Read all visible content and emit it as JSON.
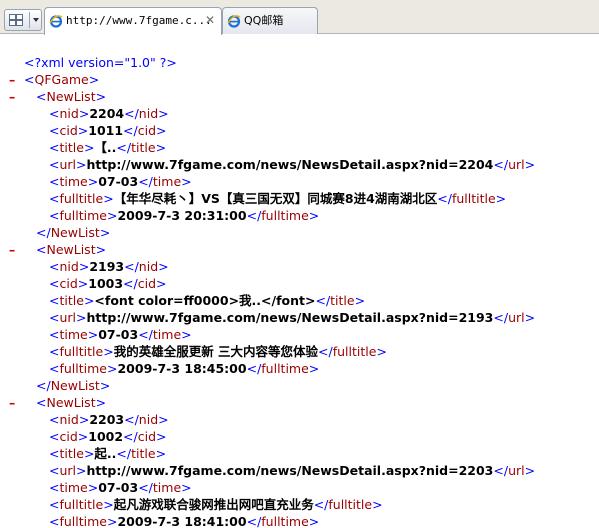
{
  "tabs": [
    {
      "title": "http://www.7fgame.c...",
      "close": "✕",
      "active": true
    },
    {
      "title": "QQ邮箱",
      "active": false
    }
  ],
  "xml": {
    "declaration": "<?xml version=\"1.0\" ?>",
    "root_tag": "QFGame",
    "item_tag": "NewList",
    "items": [
      {
        "nid": "2204",
        "cid": "1011",
        "title": "【..",
        "url": "http://www.7fgame.com/news/NewsDetail.aspx?nid=2204",
        "time": "07-03",
        "fulltitle": "【年华尽耗丶】VS【真三国无双】同城赛8进4湖南湖北区",
        "fulltime": "2009-7-3 20:31:00"
      },
      {
        "nid": "2193",
        "cid": "1003",
        "title": "<font color=ff0000>我..</font>",
        "url": "http://www.7fgame.com/news/NewsDetail.aspx?nid=2193",
        "time": "07-03",
        "fulltitle": "我的英雄全服更新 三大内容等您体验",
        "fulltime": "2009-7-3 18:45:00"
      },
      {
        "nid": "2203",
        "cid": "1002",
        "title": "起..",
        "url": "http://www.7fgame.com/news/NewsDetail.aspx?nid=2203",
        "time": "07-03",
        "fulltitle": "起凡游戏联合骏网推出网吧直充业务",
        "fulltime": "2009-7-3 18:41:00"
      }
    ]
  }
}
